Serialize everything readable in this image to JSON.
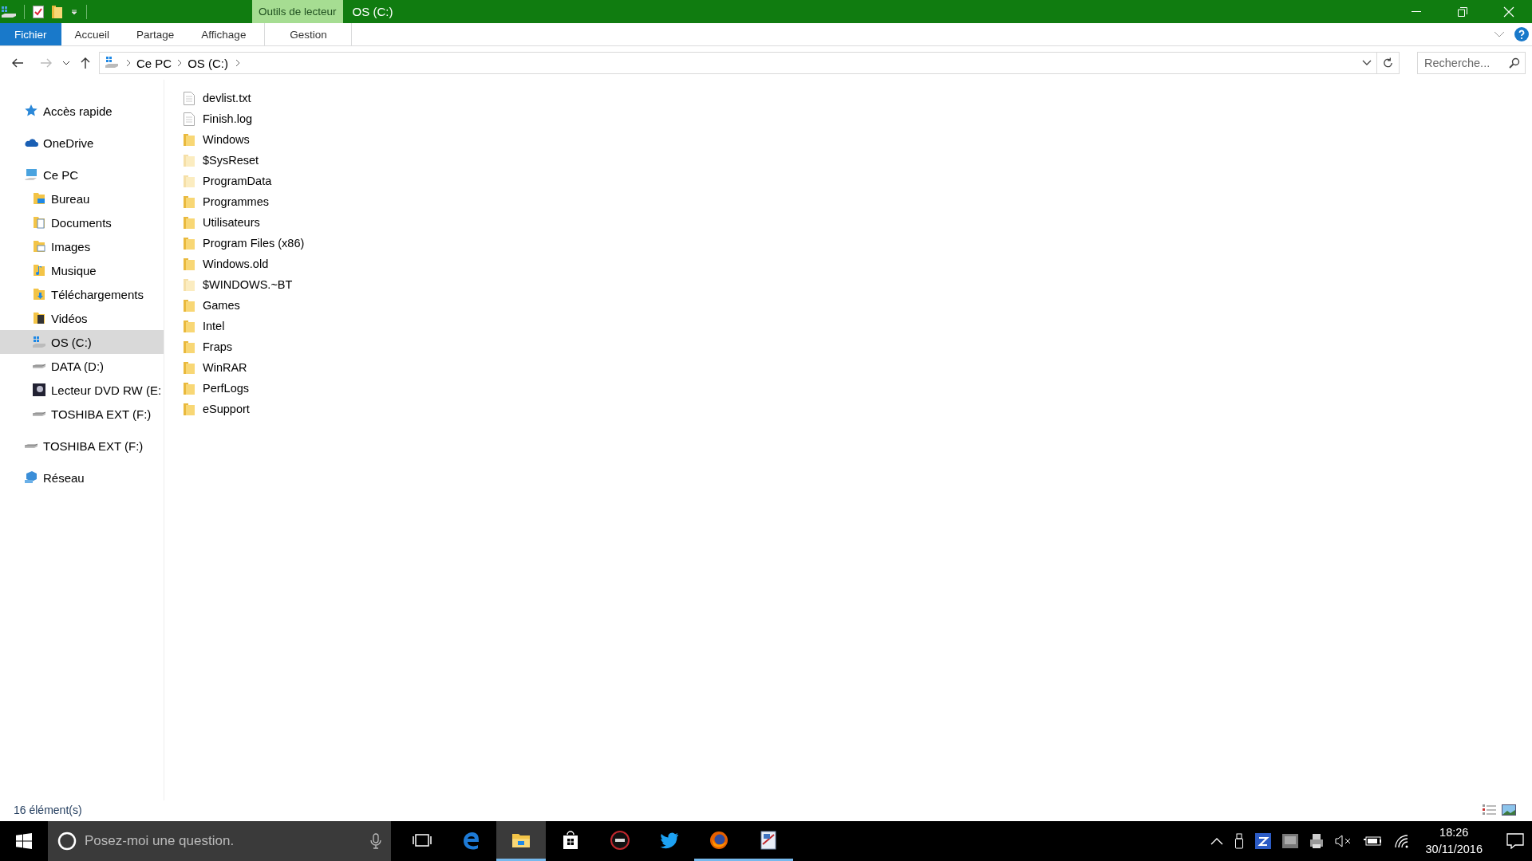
{
  "window": {
    "title": "OS (C:)",
    "context_group": "Outils de lecteur"
  },
  "ribbon_tabs": [
    {
      "label": "Fichier",
      "selected": true,
      "kind": "file"
    },
    {
      "label": "Accueil",
      "selected": false,
      "kind": "tab"
    },
    {
      "label": "Partage",
      "selected": false,
      "kind": "tab"
    },
    {
      "label": "Affichage",
      "selected": false,
      "kind": "tab"
    },
    {
      "label": "Gestion",
      "selected": false,
      "kind": "context"
    }
  ],
  "address": {
    "crumbs": [
      "Ce PC",
      "OS (C:)"
    ]
  },
  "search": {
    "placeholder": "Recherche..."
  },
  "navigation": [
    {
      "label": "Accès rapide",
      "kind": "star",
      "selected": false
    },
    {
      "label": "OneDrive",
      "kind": "cloud",
      "selected": false
    },
    {
      "label": "Ce PC",
      "kind": "computer",
      "selected": false,
      "children": [
        {
          "label": "Bureau",
          "kind": "desktop",
          "selected": false
        },
        {
          "label": "Documents",
          "kind": "documents",
          "selected": false
        },
        {
          "label": "Images",
          "kind": "pictures",
          "selected": false
        },
        {
          "label": "Musique",
          "kind": "music",
          "selected": false
        },
        {
          "label": "Téléchargements",
          "kind": "downloads",
          "selected": false
        },
        {
          "label": "Vidéos",
          "kind": "videos",
          "selected": false
        },
        {
          "label": "OS (C:)",
          "kind": "system-drive",
          "selected": true
        },
        {
          "label": "DATA (D:)",
          "kind": "drive",
          "selected": false
        },
        {
          "label": "Lecteur DVD RW (E:",
          "kind": "dvd",
          "selected": false
        },
        {
          "label": "TOSHIBA EXT (F:)",
          "kind": "drive",
          "selected": false
        }
      ]
    },
    {
      "label": "TOSHIBA EXT (F:)",
      "kind": "drive",
      "selected": false
    },
    {
      "label": "Réseau",
      "kind": "network",
      "selected": false
    }
  ],
  "files": [
    {
      "name": "devlist.txt",
      "kind": "file",
      "hidden": false
    },
    {
      "name": "Finish.log",
      "kind": "file",
      "hidden": false
    },
    {
      "name": "Windows",
      "kind": "folder",
      "hidden": false
    },
    {
      "name": "$SysReset",
      "kind": "folder",
      "hidden": true
    },
    {
      "name": "ProgramData",
      "kind": "folder",
      "hidden": true
    },
    {
      "name": "Programmes",
      "kind": "folder",
      "hidden": false
    },
    {
      "name": "Utilisateurs",
      "kind": "folder",
      "hidden": false
    },
    {
      "name": "Program Files (x86)",
      "kind": "folder",
      "hidden": false
    },
    {
      "name": "Windows.old",
      "kind": "folder",
      "hidden": false
    },
    {
      "name": "$WINDOWS.~BT",
      "kind": "folder",
      "hidden": true
    },
    {
      "name": "Games",
      "kind": "folder",
      "hidden": false
    },
    {
      "name": "Intel",
      "kind": "folder",
      "hidden": false
    },
    {
      "name": "Fraps",
      "kind": "folder",
      "hidden": false
    },
    {
      "name": "WinRAR",
      "kind": "folder",
      "hidden": false
    },
    {
      "name": "PerfLogs",
      "kind": "folder",
      "hidden": false
    },
    {
      "name": "eSupport",
      "kind": "folder",
      "hidden": false
    }
  ],
  "status_bar": {
    "count": "16 élément(s)"
  },
  "taskbar": {
    "search_placeholder": "Posez-moi une question.",
    "apps": [
      {
        "kind": "task-view",
        "selected": false,
        "running": false
      },
      {
        "kind": "edge",
        "selected": false,
        "running": false
      },
      {
        "kind": "explorer",
        "selected": true,
        "running": true
      },
      {
        "kind": "store",
        "selected": false,
        "running": false
      },
      {
        "kind": "asus",
        "selected": false,
        "running": false
      },
      {
        "kind": "twitter",
        "selected": false,
        "running": false
      },
      {
        "kind": "firefox",
        "selected": false,
        "running": true
      },
      {
        "kind": "paint",
        "selected": false,
        "running": true
      }
    ],
    "time": "18:26",
    "date": "30/11/2016"
  }
}
